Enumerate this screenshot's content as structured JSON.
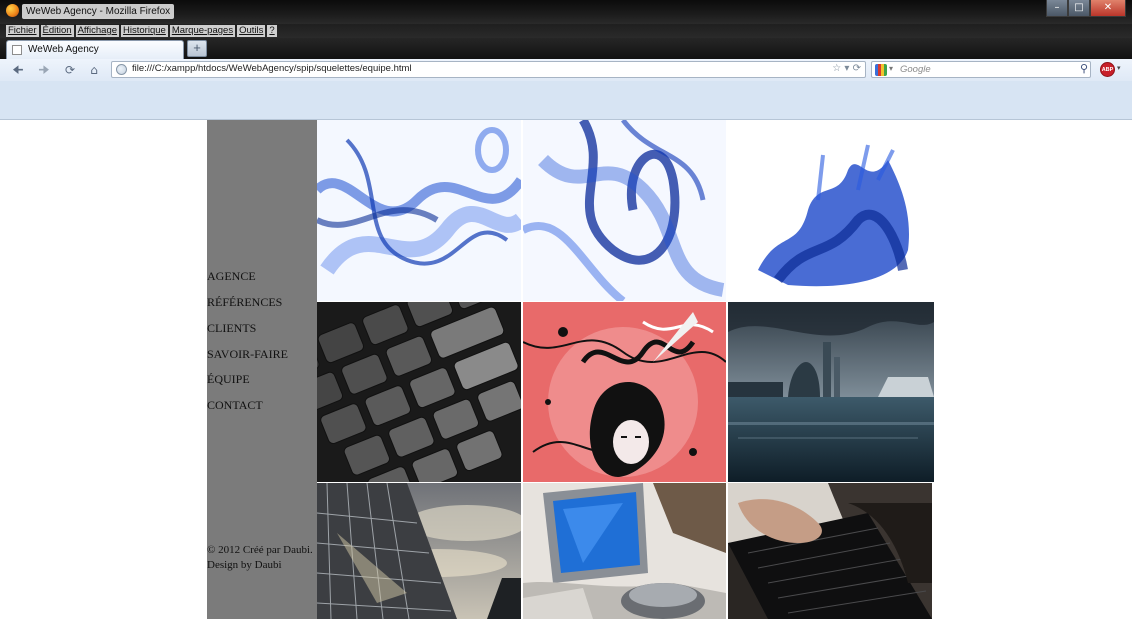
{
  "window": {
    "title": "WeWeb Agency - Mozilla Firefox",
    "controls": [
      "minimize",
      "maximize",
      "close"
    ]
  },
  "menubar": {
    "items": [
      "Fichier",
      "Édition",
      "Affichage",
      "Historique",
      "Marque-pages",
      "Outils",
      "?"
    ]
  },
  "tabs": [
    {
      "label": "WeWeb Agency",
      "active": true
    }
  ],
  "new_tab_label": "+",
  "navbar": {
    "url": "file:///C:/xampp/htdocs/WeWebAgency/spip/squelettes/equipe.html",
    "search_placeholder": "Google",
    "addon_label": "ABP"
  },
  "site": {
    "nav": [
      "AGENCE",
      "RÉFÉRENCES",
      "CLIENTS",
      "SAVOIR-FAIRE",
      "ÉQUIPE",
      "CONTACT"
    ],
    "footer_lines": [
      "© 2012 Créé par Daubi.",
      "Design by Daubi"
    ]
  },
  "gallery": [
    {
      "name": "blue-smoke-left"
    },
    {
      "name": "blue-smoke-center"
    },
    {
      "name": "blue-ink-splash"
    },
    {
      "name": "keyboard-closeup"
    },
    {
      "name": "red-art-illustration"
    },
    {
      "name": "flooded-city"
    },
    {
      "name": "glass-building"
    },
    {
      "name": "computer-monitor"
    },
    {
      "name": "hand-on-keyboard"
    }
  ],
  "colors": {
    "sidebar": "#7b7b7b",
    "chrome_dark": "#121212",
    "toolbar": "#dfe9f6"
  }
}
